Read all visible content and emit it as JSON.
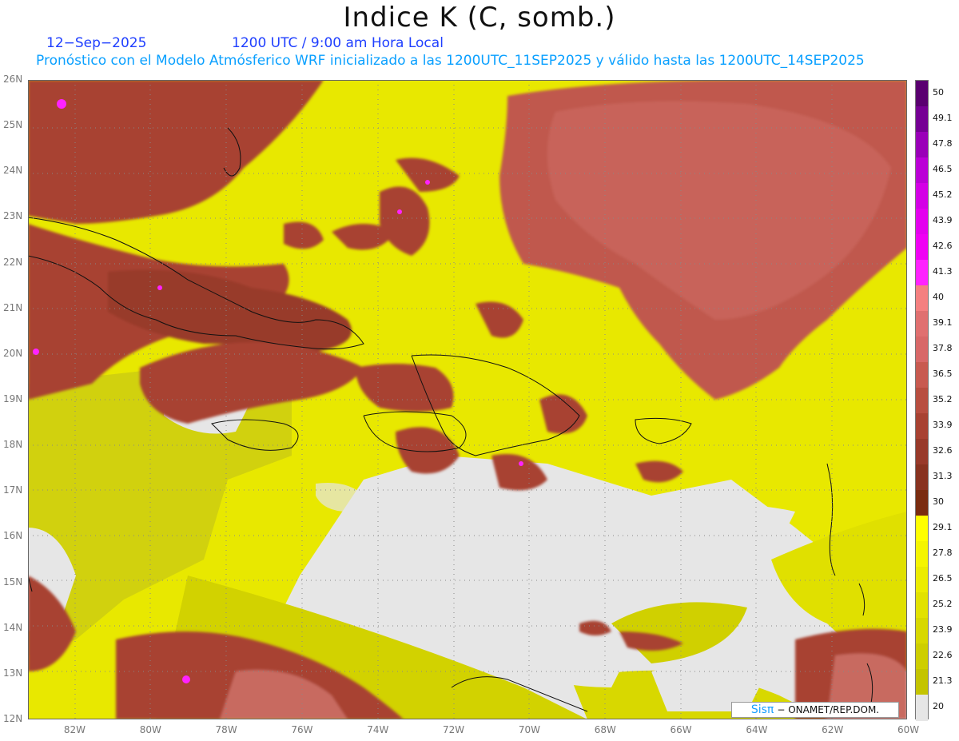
{
  "title": "Indice K (C, somb.)",
  "date": "12−Sep−2025",
  "time": "1200 UTC / 9:00 am Hora Local",
  "description": "Pronóstico con el Modelo Atmósferico WRF inicializado a las 1200UTC_11SEP2025 y válido hasta las  1200UTC_14SEP2025",
  "map": {
    "lon_range": [
      -83.2,
      -60.0
    ],
    "lat_range": [
      12.0,
      26.0
    ],
    "lon_ticks": [
      "82W",
      "80W",
      "78W",
      "76W",
      "74W",
      "72W",
      "70W",
      "68W",
      "66W",
      "64W",
      "62W",
      "60W"
    ],
    "lat_ticks": [
      "12N",
      "13N",
      "14N",
      "15N",
      "16N",
      "17N",
      "18N",
      "19N",
      "20N",
      "21N",
      "22N",
      "23N",
      "24N",
      "25N",
      "26N"
    ],
    "grid_style": "dotted"
  },
  "colorbar": {
    "levels": [
      "50",
      "49.1",
      "47.8",
      "46.5",
      "45.2",
      "43.9",
      "42.6",
      "41.3",
      "40",
      "39.1",
      "37.8",
      "36.5",
      "35.2",
      "33.9",
      "32.6",
      "31.3",
      "30",
      "29.1",
      "27.8",
      "26.5",
      "25.2",
      "23.9",
      "22.6",
      "21.3",
      "20"
    ],
    "colors": [
      "#5a0070",
      "#760094",
      "#9a00b8",
      "#bb00d6",
      "#d400e6",
      "#e400ee",
      "#f000f4",
      "#ff22ff",
      "#f48080",
      "#e07070",
      "#d86868",
      "#c85a50",
      "#b84e40",
      "#a84232",
      "#983a2a",
      "#883320",
      "#7a2c10",
      "#ffff00",
      "#f5f500",
      "#ecec00",
      "#e2e200",
      "#d8d800",
      "#cece00",
      "#c4c400",
      "#e6e6e6"
    ]
  },
  "credit": {
    "logo": "Sisπ",
    "text": "− ONAMET/REP.DOM."
  }
}
